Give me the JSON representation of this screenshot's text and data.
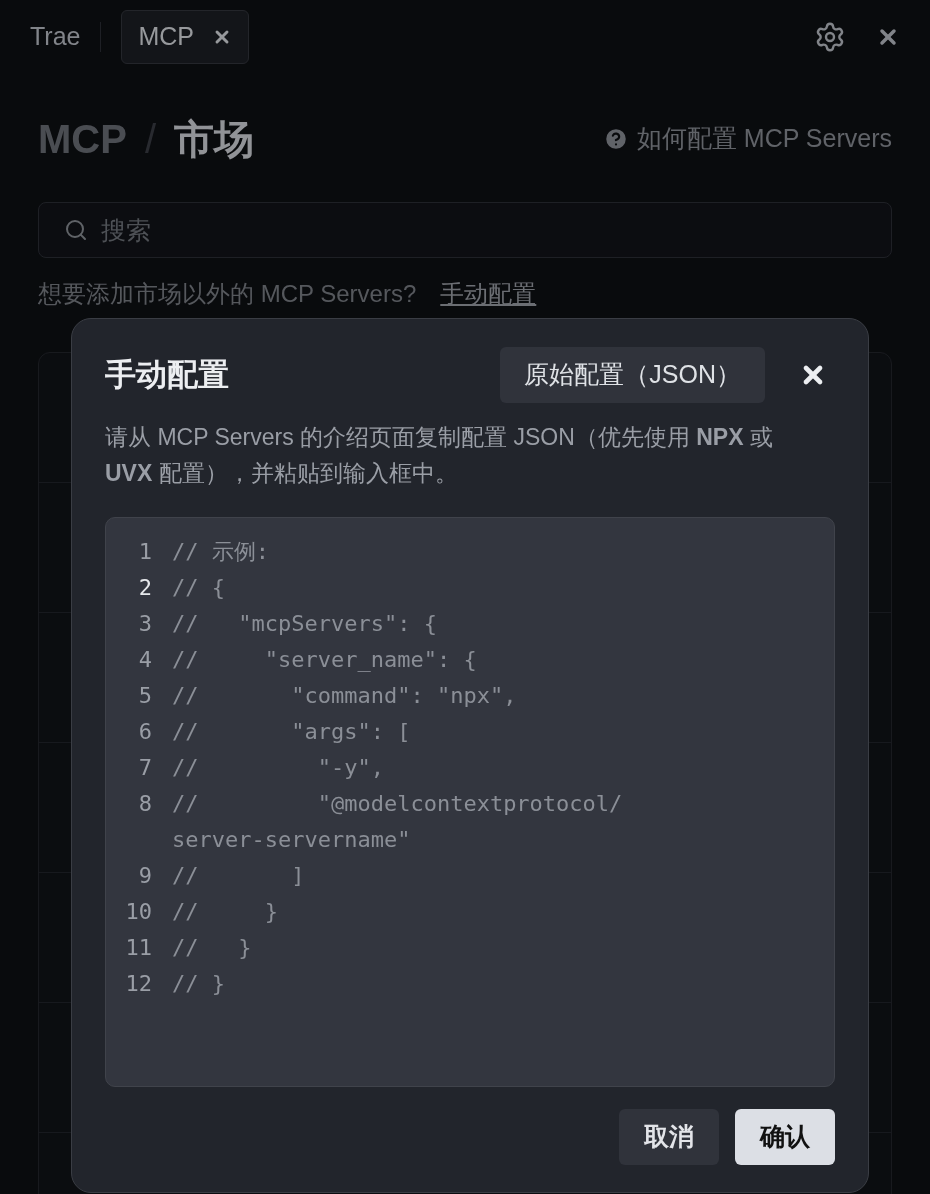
{
  "tabs": [
    {
      "label": "Trae",
      "selected": false,
      "closable": false
    },
    {
      "label": "MCP",
      "selected": true,
      "closable": true
    }
  ],
  "header": {
    "breadcrumb": [
      "MCP",
      "市场"
    ],
    "separator": "/",
    "help_link": "如何配置 MCP Servers"
  },
  "search": {
    "placeholder": "搜索"
  },
  "hint": {
    "text": "想要添加市场以外的 MCP Servers?",
    "link": "手动配置"
  },
  "dialog": {
    "title": "手动配置",
    "mode_button": "原始配置（JSON）",
    "description": "请从 MCP Servers 的介绍页面复制配置 JSON（优先使用 **NPX** 或 **UVX** 配置），并粘贴到输入框中。",
    "editor": {
      "lines": [
        {
          "number": "1",
          "text": "// 示例:",
          "active": false
        },
        {
          "number": "2",
          "text": "// {",
          "active": true
        },
        {
          "number": "3",
          "text": "//   \"mcpServers\": {",
          "active": false
        },
        {
          "number": "4",
          "text": "//     \"server_name\": {",
          "active": false
        },
        {
          "number": "5",
          "text": "//       \"command\": \"npx\",",
          "active": false
        },
        {
          "number": "6",
          "text": "//       \"args\": [",
          "active": false
        },
        {
          "number": "7",
          "text": "//         \"-y\",",
          "active": false
        },
        {
          "number": "8",
          "text": "//         \"@modelcontextprotocol/server-servername\"",
          "active": false
        },
        {
          "number": "9",
          "text": "//       ]",
          "active": false
        },
        {
          "number": "10",
          "text": "//     }",
          "active": false
        },
        {
          "number": "11",
          "text": "//   }",
          "active": false
        },
        {
          "number": "12",
          "text": "// }",
          "active": false
        }
      ]
    },
    "buttons": [
      {
        "label": "取消",
        "kind": "secondary"
      },
      {
        "label": "确认",
        "kind": "primary"
      }
    ]
  }
}
